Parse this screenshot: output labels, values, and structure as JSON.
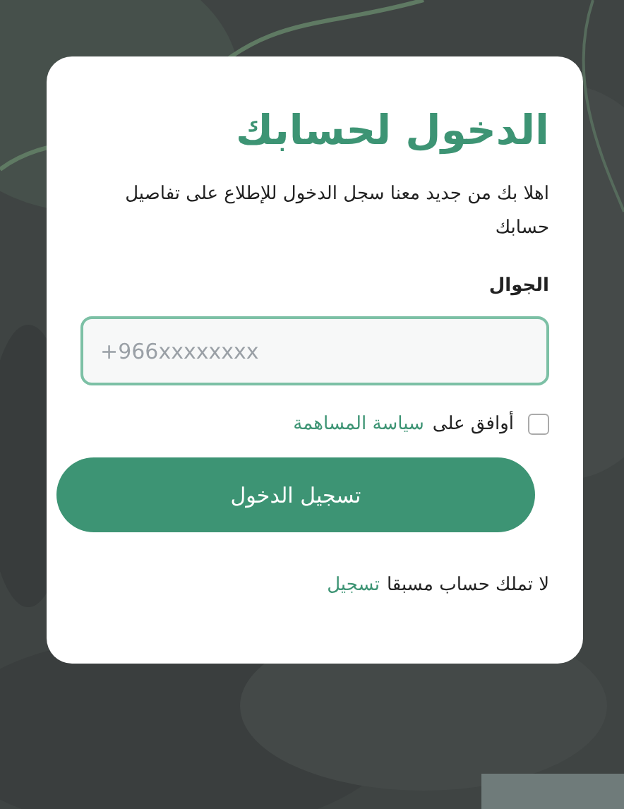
{
  "login": {
    "title": "الدخول لحسابك",
    "intro": "اهلا بك من جديد معنا سجل الدخول للإطلاع على تفاصيل حسابك",
    "phone": {
      "label": "الجوال",
      "placeholder": "+966xxxxxxxx"
    },
    "agreement": {
      "checked": false,
      "text": "أوافق على",
      "link": "سياسة المساهمة"
    },
    "submit": "تسجيل الدخول",
    "footer": {
      "text": "لا تملك حساب مسبقا",
      "link": "تسجيل"
    }
  }
}
